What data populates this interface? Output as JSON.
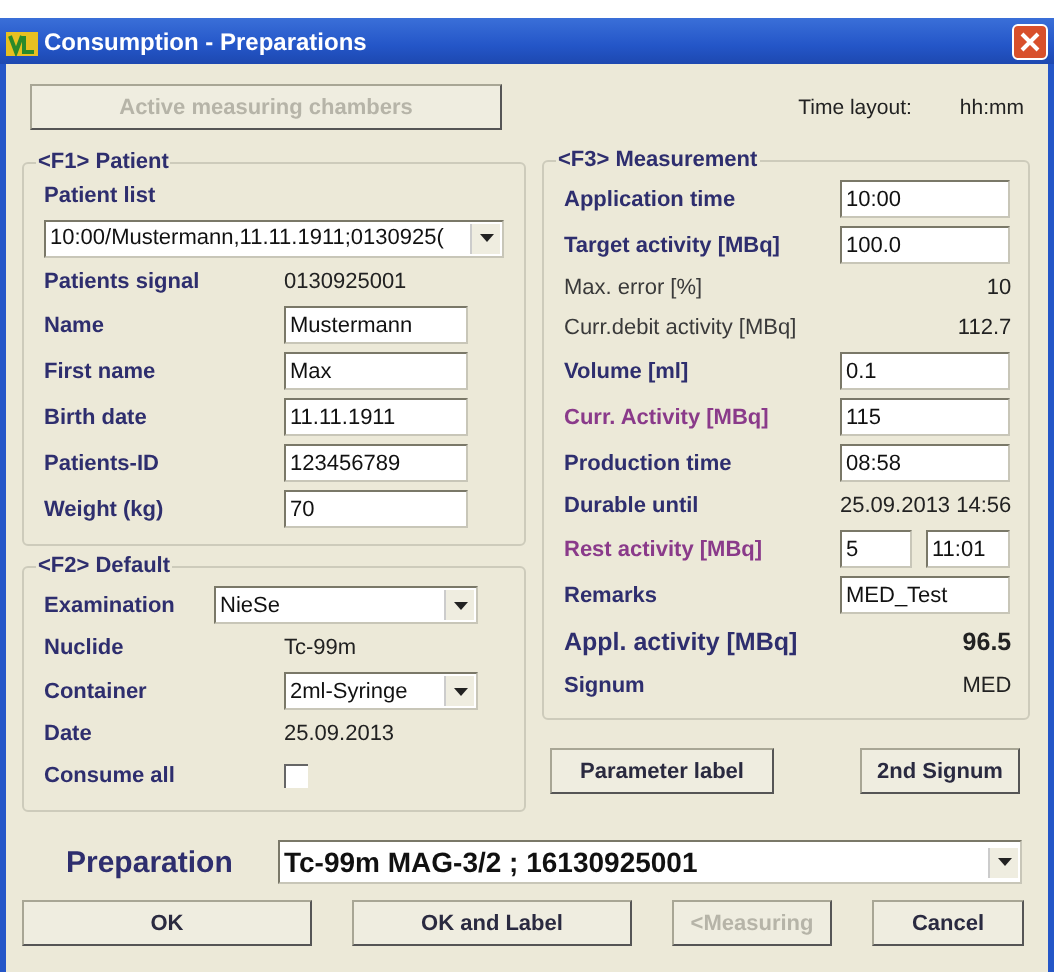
{
  "window": {
    "title": "Consumption - Preparations"
  },
  "chambers_button": {
    "label": "Active measuring chambers",
    "disabled": true
  },
  "time_layout": {
    "label": "Time layout:",
    "value": "hh:mm"
  },
  "patient": {
    "title": "<F1> Patient",
    "rows": [
      {
        "kind": "heading",
        "label": "Patient list",
        "bold": true,
        "highlighted": false
      },
      {
        "kind": "list",
        "value": "10:00/Mustermann,11.11.1911;0130925("
      },
      {
        "kind": "value",
        "label": "Patients signal",
        "value": "0130925001",
        "bold": true,
        "highlighted": false
      },
      {
        "kind": "input",
        "label": "Name",
        "value": "Mustermann",
        "bold": true,
        "highlighted": false
      },
      {
        "kind": "input",
        "label": "First name",
        "value": "Max",
        "bold": true,
        "highlighted": false
      },
      {
        "kind": "input",
        "label": "Birth date",
        "value": "11.11.1911",
        "bold": true,
        "highlighted": false
      },
      {
        "kind": "input",
        "label": "Patients-ID",
        "value": "123456789",
        "bold": true,
        "highlighted": false
      },
      {
        "kind": "input",
        "label": "Weight (kg)",
        "value": "70",
        "bold": true,
        "highlighted": false
      }
    ]
  },
  "default": {
    "title": "<F2> Default",
    "rows": [
      {
        "kind": "combo",
        "label": "Examination",
        "value": "NieSe",
        "bold": true,
        "highlighted": false
      },
      {
        "kind": "value",
        "label": "Nuclide",
        "value": "Tc-99m",
        "bold": true,
        "highlighted": false
      },
      {
        "kind": "select",
        "label": "Container",
        "value": "2ml-Syringe",
        "bold": true,
        "highlighted": false
      },
      {
        "kind": "value",
        "label": "Date",
        "value": "25.09.2013",
        "bold": true,
        "highlighted": false
      },
      {
        "kind": "checkbox",
        "label": "Consume all",
        "checked": false,
        "bold": true,
        "highlighted": false
      }
    ]
  },
  "measurement": {
    "title": "<F3> Measurement",
    "rows": [
      {
        "kind": "input",
        "label": "Application time",
        "value": "10:00",
        "bold": true,
        "highlighted": false,
        "large": false
      },
      {
        "kind": "input",
        "label": "Target activity [MBq]",
        "value": "100.0",
        "bold": true,
        "highlighted": false,
        "large": false
      },
      {
        "kind": "value",
        "label": "Max. error [%]",
        "value": "10",
        "bold": false,
        "highlighted": false,
        "large": false
      },
      {
        "kind": "value",
        "label": "Curr.debit activity [MBq]",
        "value": "112.7",
        "bold": false,
        "highlighted": false,
        "large": false
      },
      {
        "kind": "input",
        "label": "Volume [ml]",
        "value": "0.1",
        "bold": true,
        "highlighted": false,
        "large": false
      },
      {
        "kind": "input",
        "label": "Curr. Activity [MBq]",
        "value": "115",
        "bold": true,
        "highlighted": true,
        "large": false
      },
      {
        "kind": "input",
        "label": "Production time",
        "value": "08:58",
        "bold": true,
        "highlighted": false,
        "large": false
      },
      {
        "kind": "value",
        "label": "Durable until",
        "value": "25.09.2013 14:56",
        "bold": true,
        "highlighted": false,
        "large": false
      },
      {
        "kind": "pair",
        "label": "Rest activity [MBq]",
        "value": "5",
        "value_2": "11:01",
        "bold": true,
        "highlighted": true,
        "large": false
      },
      {
        "kind": "input",
        "label": "Remarks",
        "value": "MED_Test",
        "bold": true,
        "highlighted": false,
        "large": false
      },
      {
        "kind": "value",
        "label": "Appl. activity [MBq]",
        "value": "96.5",
        "bold": true,
        "highlighted": false,
        "large": true
      },
      {
        "kind": "value",
        "label": "Signum",
        "value": "MED",
        "bold": true,
        "highlighted": false,
        "large": false
      }
    ]
  },
  "actions": [
    {
      "label": "Parameter label",
      "disabled": false
    },
    {
      "label": "2nd Signum",
      "disabled": false
    }
  ],
  "preparation": {
    "label": "Preparation",
    "value": "Tc-99m MAG-3/2 ; 16130925001"
  },
  "buttons": [
    {
      "label": "OK",
      "disabled": false
    },
    {
      "label": "OK and Label",
      "disabled": false
    },
    {
      "label": "<Measuring",
      "disabled": true
    },
    {
      "label": "Cancel",
      "disabled": false
    }
  ]
}
